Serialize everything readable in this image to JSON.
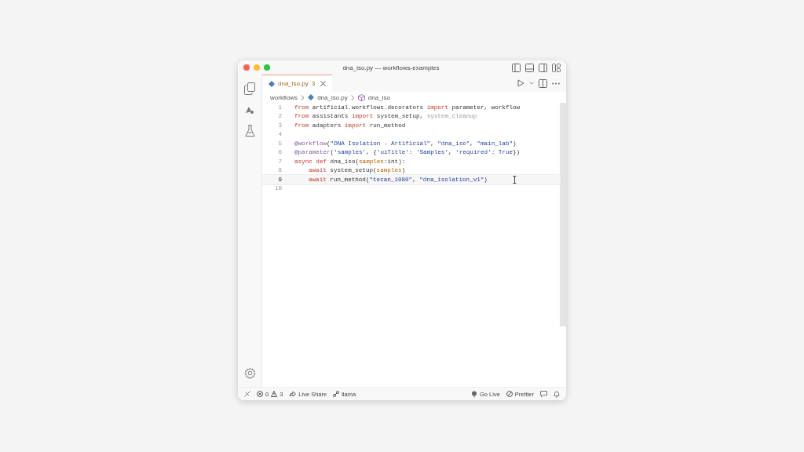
{
  "window": {
    "title": "dna_iso.py — workflows-examples"
  },
  "tabs": [
    {
      "label": "dna_iso.py",
      "badge": "3",
      "selected": true
    }
  ],
  "breadcrumb": [
    "workflows",
    "dna_iso.py",
    "dna_iso"
  ],
  "code": {
    "lines": [
      {
        "number": "1",
        "current": false,
        "tokens": [
          {
            "kind": "keyword",
            "text": "from"
          },
          {
            "kind": "plain",
            "text": " artificial.workflows.decorators "
          },
          {
            "kind": "keyword",
            "text": "import"
          },
          {
            "kind": "plain",
            "text": " parameter, workflow"
          }
        ]
      },
      {
        "number": "2",
        "current": false,
        "tokens": [
          {
            "kind": "keyword",
            "text": "from"
          },
          {
            "kind": "plain",
            "text": " assistants "
          },
          {
            "kind": "keyword",
            "text": "import"
          },
          {
            "kind": "plain",
            "text": " system_setup, "
          },
          {
            "kind": "dim",
            "text": "system_cleanup"
          }
        ]
      },
      {
        "number": "3",
        "current": false,
        "tokens": [
          {
            "kind": "keyword",
            "text": "from"
          },
          {
            "kind": "plain",
            "text": " adapters "
          },
          {
            "kind": "keyword",
            "text": "import"
          },
          {
            "kind": "plain",
            "text": " run_method"
          }
        ]
      },
      {
        "number": "4",
        "current": false
      },
      {
        "number": "5",
        "current": false,
        "tokens": [
          {
            "kind": "decorator",
            "text": "@workflow"
          },
          {
            "kind": "plain",
            "text": "("
          },
          {
            "kind": "string",
            "text": "\"DNA Isolation - Artificial\""
          },
          {
            "kind": "plain",
            "text": ", "
          },
          {
            "kind": "string",
            "text": "\"dna_iso\""
          },
          {
            "kind": "plain",
            "text": ", "
          },
          {
            "kind": "string",
            "text": "\"main_lab\""
          },
          {
            "kind": "plain",
            "text": ")"
          }
        ]
      },
      {
        "number": "6",
        "current": false,
        "tokens": [
          {
            "kind": "decorator",
            "text": "@parameter"
          },
          {
            "kind": "plain",
            "text": "("
          },
          {
            "kind": "string",
            "text": "'samples'"
          },
          {
            "kind": "plain",
            "text": ", {"
          },
          {
            "kind": "string",
            "text": "'uiTitle'"
          },
          {
            "kind": "plain",
            "text": ": "
          },
          {
            "kind": "string",
            "text": "'Samples'"
          },
          {
            "kind": "plain",
            "text": ", "
          },
          {
            "kind": "string",
            "text": "'required'"
          },
          {
            "kind": "plain",
            "text": ": "
          },
          {
            "kind": "constant",
            "text": "True"
          },
          {
            "kind": "plain",
            "text": "})"
          }
        ]
      },
      {
        "number": "7",
        "current": false,
        "tokens": [
          {
            "kind": "keyword",
            "text": "async def"
          },
          {
            "kind": "plain",
            "text": " dna_iso("
          },
          {
            "kind": "variable",
            "text": "samples"
          },
          {
            "kind": "plain",
            "text": ":int):"
          }
        ]
      },
      {
        "number": "8",
        "current": false,
        "indented": true,
        "tokens": [
          {
            "kind": "keyword",
            "text": "await"
          },
          {
            "kind": "plain",
            "text": " system_setup("
          },
          {
            "kind": "variable",
            "text": "samples"
          },
          {
            "kind": "plain",
            "text": ")"
          }
        ]
      },
      {
        "number": "9",
        "current": true,
        "indented": true,
        "tokens": [
          {
            "kind": "keyword",
            "text": "await"
          },
          {
            "kind": "plain",
            "text": " run_method("
          },
          {
            "kind": "string",
            "text": "\"tecan_1080\""
          },
          {
            "kind": "plain",
            "text": ", "
          },
          {
            "kind": "string",
            "text": "\"dna_isolation_v1\""
          },
          {
            "kind": "plain",
            "text": ")"
          }
        ]
      },
      {
        "number": "10",
        "current": false
      }
    ]
  },
  "status_bar": {
    "errors": "0",
    "warnings": "3",
    "left": [
      "Live Share",
      "llama"
    ],
    "right": [
      "Go Live",
      "Prettier"
    ]
  }
}
